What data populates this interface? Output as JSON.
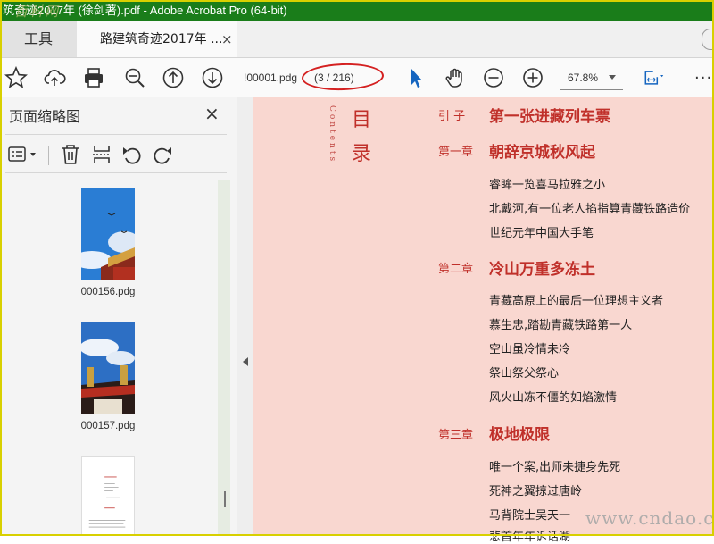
{
  "window": {
    "title": "筑奇迹2017年 (徐剑著).pdf - Adobe Acrobat Pro (64-bit)"
  },
  "watermark_top": "百科网",
  "watermark_bottom": "www.cndao.com",
  "tabs": {
    "tools": "工具",
    "document": "路建筑奇迹2017年 ...",
    "close": "×"
  },
  "toolbar": {
    "icons": [
      "star-icon",
      "cloud-upload-icon",
      "print-icon",
      "zoom-out-magnifier-icon",
      "page-up-icon",
      "page-down-icon",
      "select-arrow-icon",
      "hand-icon",
      "minus-circle-icon",
      "plus-circle-icon",
      "fit-page-icon",
      "more-icon"
    ],
    "page_input": "!00001.pdg",
    "page_count": "(3 / 216)",
    "zoom": "67.8%",
    "more": "···"
  },
  "sidebar": {
    "title": "页面缩略图",
    "close": "×",
    "thumbnails": [
      {
        "label": "000156.pdg"
      },
      {
        "label": "000157.pdg"
      },
      {
        "label": ""
      }
    ]
  },
  "document": {
    "contents_word": "Contents",
    "mulu_1": "目",
    "mulu_2": "录",
    "chapters": [
      {
        "label": "引  子",
        "title": "第一张进藏列车票",
        "items": []
      },
      {
        "label": "第一章",
        "title": "朝辞京城秋风起",
        "items": [
          "睿眸一览喜马拉雅之小",
          "北戴河,有一位老人掐指算青藏铁路造价",
          "世纪元年中国大手笔"
        ]
      },
      {
        "label": "第二章",
        "title": "冷山万重多冻土",
        "items": [
          "青藏高原上的最后一位理想主义者",
          "慕生忠,踏勘青藏铁路第一人",
          "空山虽冷情未冷",
          "祭山祭父祭心",
          "风火山冻不僵的如焰激情"
        ]
      },
      {
        "label": "第三章",
        "title": "极地极限",
        "items": [
          "唯一个案,出师未捷身先死",
          "死神之翼掠过唐岭",
          "马背院士吴天一",
          "悲首年年诉话湖"
        ]
      }
    ]
  },
  "colors": {
    "titlebar": "#1a7d1a",
    "accent_red": "#c0302a",
    "page_bg": "#f9d7d0",
    "annotation": "#d42020",
    "tool_blue": "#1565c0"
  }
}
